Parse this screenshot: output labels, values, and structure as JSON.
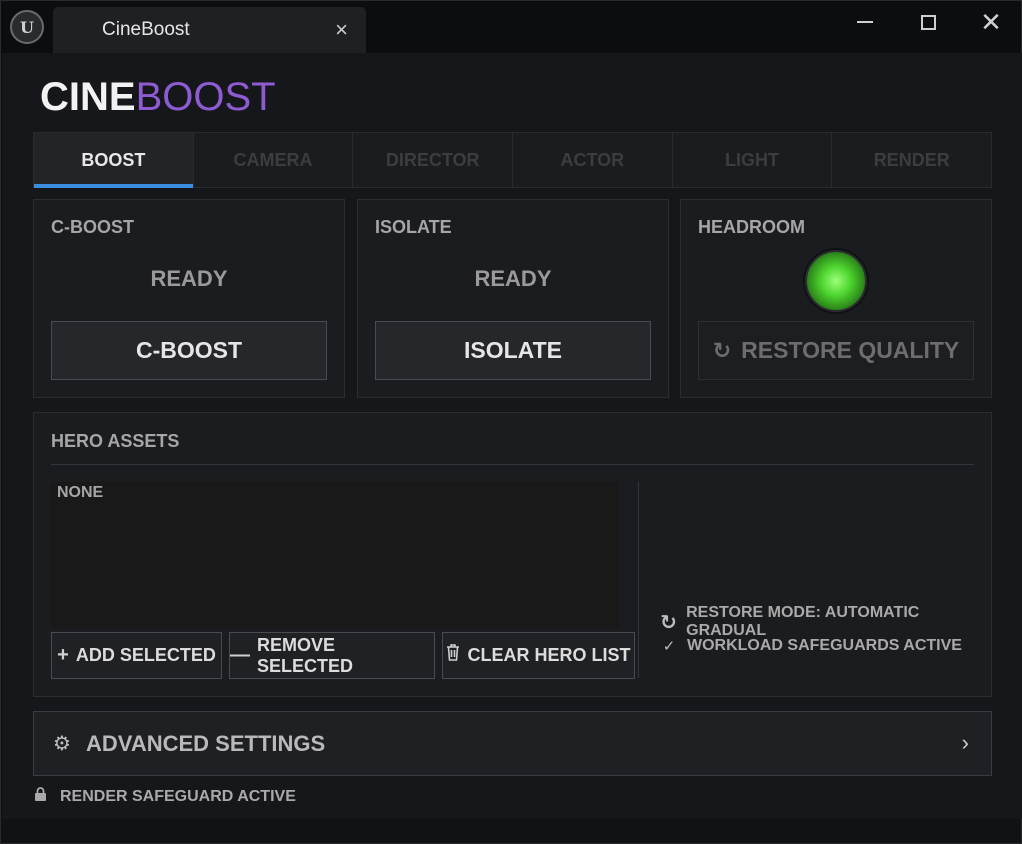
{
  "titlebar": {
    "app_logo": "U",
    "tab_title": "CineBoost",
    "close_glyph": "×",
    "window_close_glyph": "✕"
  },
  "brand": {
    "part1": "CINE",
    "part2": "BOOST",
    "part1_color": "#f2f2f2",
    "part2_color": "#8e5bd3"
  },
  "tabs": [
    {
      "label": "BOOST",
      "active": true
    },
    {
      "label": "CAMERA",
      "active": false
    },
    {
      "label": "DIRECTOR",
      "active": false
    },
    {
      "label": "ACTOR",
      "active": false
    },
    {
      "label": "LIGHT",
      "active": false
    },
    {
      "label": "RENDER",
      "active": false
    }
  ],
  "accent_color": "#3b8de0",
  "panels": {
    "cboost": {
      "title": "C-BOOST",
      "status": "READY",
      "button": "C-BOOST"
    },
    "isolate": {
      "title": "ISOLATE",
      "status": "READY",
      "button": "ISOLATE"
    },
    "headroom": {
      "title": "HEADROOM",
      "indicator": "green",
      "button": "RESTORE QUALITY",
      "button_icon": "refresh-icon"
    }
  },
  "hero": {
    "title": "HERO ASSETS",
    "list_empty": "NONE",
    "buttons": {
      "add": "ADD SELECTED",
      "remove": "REMOVE SELECTED",
      "clear": "CLEAR HERO LIST"
    },
    "restore_mode": "RESTORE MODE: AUTOMATIC GRADUAL",
    "safeguards": "WORKLOAD SAFEGUARDS ACTIVE"
  },
  "advanced": {
    "label": "ADVANCED SETTINGS"
  },
  "footer": {
    "text": "RENDER SAFEGUARD ACTIVE"
  }
}
